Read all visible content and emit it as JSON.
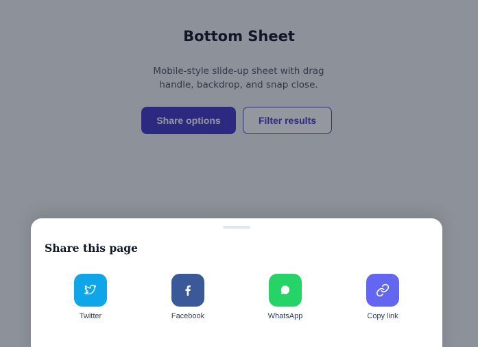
{
  "page": {
    "title": "Bottom Sheet",
    "subtitle": "Mobile-style slide-up sheet with drag handle, backdrop, and snap close."
  },
  "buttons": {
    "share_label": "Share options",
    "filter_label": "Filter results"
  },
  "sheet": {
    "title": "Share this page",
    "items": [
      {
        "label": "Twitter",
        "icon": "twitter-icon",
        "color": "#0ea5e9"
      },
      {
        "label": "Facebook",
        "icon": "facebook-icon",
        "color": "#3b5998"
      },
      {
        "label": "WhatsApp",
        "icon": "whatsapp-icon",
        "color": "#25d366"
      },
      {
        "label": "Copy link",
        "icon": "link-icon",
        "color": "#6366f1"
      }
    ]
  },
  "colors": {
    "accent": "#4338ca",
    "backdrop": "rgba(17, 24, 39, 0.45)"
  }
}
